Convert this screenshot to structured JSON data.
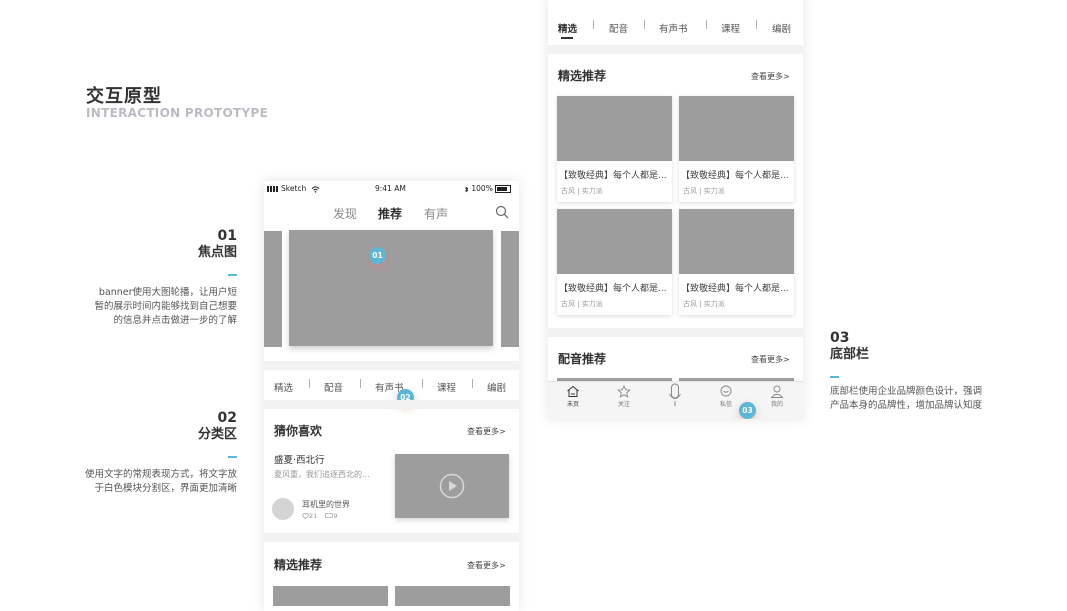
{
  "page": {
    "title": "交互原型",
    "subtitle": "INTERACTION PROTOTYPE"
  },
  "annotations": [
    {
      "num": "01",
      "title": "焦点图",
      "lines": [
        "banner使用大图轮播，让用户短",
        "暂的展示时间内能够找到自己想要",
        "的信息并点击做进一步的了解"
      ]
    },
    {
      "num": "02",
      "title": "分类区",
      "lines": [
        "使用文字的常规表现方式，将文字放",
        "于白色模块分割区，界面更加清晰"
      ]
    },
    {
      "num": "03",
      "title": "底部栏",
      "lines": [
        "底部栏使用企业品牌颜色设计，强调",
        "产品本身的品牌性，增加品牌认知度"
      ]
    }
  ],
  "phone_a": {
    "status": {
      "carrier": "Sketch",
      "time": "9:41 AM",
      "battery": "100%"
    },
    "top_tabs": [
      "发现",
      "推荐",
      "有声"
    ],
    "active_top_tab": "推荐",
    "badge_banner": "01",
    "categories": [
      "精选",
      "配音",
      "有声书",
      "课程",
      "编剧"
    ],
    "badge_category": "02",
    "guess_section": {
      "title": "猜你喜欢",
      "more": "查看更多>",
      "item_title": "盛夏·西北行",
      "item_desc": "夏风重，我们追逐西北的...",
      "author": "耳机里的世界",
      "likes": "21",
      "comments": "9"
    },
    "featured_section": {
      "title": "精选推荐",
      "more": "查看更多>"
    }
  },
  "phone_b": {
    "categories": [
      "精选",
      "配音",
      "有声书",
      "课程",
      "编剧"
    ],
    "active_category": "精选",
    "featured_section": {
      "title": "精选推荐",
      "more": "查看更多>"
    },
    "cards": [
      {
        "title": "【致敬经典】每个人都是...",
        "tags": "古风 | 实力派"
      },
      {
        "title": "【致敬经典】每个人都是...",
        "tags": "古风 | 实力派"
      },
      {
        "title": "【致敬经典】每个人都是...",
        "tags": "古风 | 实力派"
      },
      {
        "title": "【致敬经典】每个人都是...",
        "tags": "古风 | 实力派"
      }
    ],
    "dubbing_section": {
      "title": "配音推荐",
      "more": "查看更多>"
    },
    "bottom_nav": [
      {
        "label": "未页",
        "icon": "home-icon"
      },
      {
        "label": "关注",
        "icon": "star-icon"
      },
      {
        "label": "",
        "icon": "microphone-icon"
      },
      {
        "label": "私信",
        "icon": "message-icon"
      },
      {
        "label": "我的",
        "icon": "user-icon"
      }
    ],
    "badge_nav": "03"
  },
  "colors": {
    "accent": "#5bb7d6",
    "placeholder": "#9d9d9d",
    "divider": "#f2f2f2"
  }
}
